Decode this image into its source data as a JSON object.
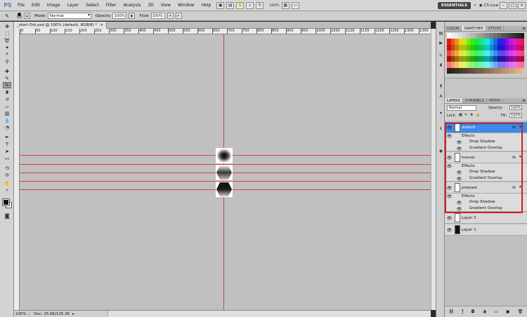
{
  "menubar": {
    "logo": "PS",
    "items": [
      "File",
      "Edit",
      "Image",
      "Layer",
      "Select",
      "Filter",
      "Analysis",
      "3D",
      "View",
      "Window",
      "Help"
    ],
    "zoom": "100%",
    "workspace": "ESSENTIALS",
    "cs_live": "CS Live",
    "window_buttons": [
      "–",
      "□",
      "×"
    ]
  },
  "options": {
    "brush_size": "50",
    "mode_label": "Mode:",
    "mode_value": "Normal",
    "opacity_label": "Opacity:",
    "opacity_value": "100%",
    "flow_label": "Flow:",
    "flow_value": "100%"
  },
  "document": {
    "tab_title": "_start Orb.psd @ 100% (default, RGB/8) *",
    "close": "×"
  },
  "ruler": {
    "ticks": [
      "0",
      "50",
      "100",
      "150",
      "200",
      "250",
      "300",
      "350",
      "400",
      "450",
      "500",
      "550",
      "600",
      "650",
      "700",
      "750",
      "800",
      "850",
      "900",
      "950",
      "1000",
      "1050",
      "1100",
      "1150",
      "1200",
      "1250",
      "1300",
      "1350"
    ]
  },
  "status": {
    "zoom": "100%",
    "doc": "Doc: 25.6K/125.3K",
    "arrow": "▸"
  },
  "panels": {
    "swatch_tabs": [
      "COLOR",
      "SWATCHES",
      "STYLES"
    ],
    "layer_tabs": [
      "LAYERS",
      "CHANNELS",
      "PATHS"
    ],
    "blend_mode": "Normal",
    "opacity_label": "Opacity:",
    "opacity_value": "100%",
    "lock_label": "Lock:",
    "fill_label": "Fill:",
    "fill_value": "100%"
  },
  "layers": {
    "default": {
      "name": "default",
      "fx": "fx",
      "effects": "Effects",
      "e1": "Drop Shadow",
      "e2": "Gradient Overlay"
    },
    "hoover": {
      "name": "hoover",
      "fx": "fx",
      "effects": "Effects",
      "e1": "Drop Shadow",
      "e2": "Gradient Overlay"
    },
    "pressed": {
      "name": "pressed",
      "fx": "fx",
      "effects": "Effects",
      "e1": "Drop Shadow",
      "e2": "Gradient Overlay"
    },
    "layer2": {
      "name": "Layer 2"
    },
    "layer1": {
      "name": "Layer 1"
    }
  },
  "colors": {
    "guide": "#d64040",
    "selected_layer": "#3b8be8",
    "highlight": "#d02020",
    "canvas": "#c0c0c0"
  }
}
